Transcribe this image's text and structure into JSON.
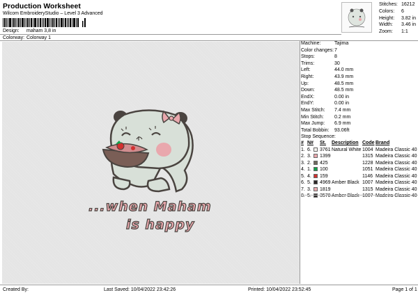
{
  "header": {
    "title": "Production Worksheet",
    "subtitle": "Wilcom EmbroideryStudio – Level 3 Advanced",
    "design_label": "Design:",
    "design_value": "maham 3,8 in",
    "colorway_label": "Colorway:",
    "colorway_value": "Colorway 1"
  },
  "top_stats": [
    {
      "label": "Stitches:",
      "value": "16212"
    },
    {
      "label": "Colors:",
      "value": "6"
    },
    {
      "label": "Height:",
      "value": "3.82 in"
    },
    {
      "label": "Width:",
      "value": "3.46 in"
    },
    {
      "label": "Zoom:",
      "value": "1:1"
    }
  ],
  "details": [
    {
      "label": "Machine:",
      "value": "Tajima"
    },
    {
      "label": "Color changes:",
      "value": "7"
    },
    {
      "label": "Stops:",
      "value": "8"
    },
    {
      "label": "Trims:",
      "value": "30"
    },
    {
      "label": "Left:",
      "value": "44.0 mm"
    },
    {
      "label": "Right:",
      "value": "43.9 mm"
    },
    {
      "label": "Up:",
      "value": "48.5 mm"
    },
    {
      "label": "Down:",
      "value": "48.5 mm"
    },
    {
      "label": "EndX:",
      "value": "0.00 in"
    },
    {
      "label": "EndY:",
      "value": "0.00 in"
    },
    {
      "label": "Max Stitch:",
      "value": "7.4 mm"
    },
    {
      "label": "Min Stitch:",
      "value": "0.2 mm"
    },
    {
      "label": "Max Jump:",
      "value": "6.9 mm"
    },
    {
      "label": "Total Bobbin:",
      "value": "93.06ft"
    }
  ],
  "stop_sequence": {
    "title": "Stop Sequence:",
    "headers": [
      "#",
      "N#",
      "St.",
      "Description",
      "Code",
      "Brand"
    ],
    "rows": [
      {
        "num": "1.",
        "n": "6.",
        "color": "#f4f2ee",
        "st": "3761",
        "desc": "Natural White",
        "code": "1004",
        "brand": "Madeira Classic 40"
      },
      {
        "num": "2.",
        "n": "3.",
        "color": "#e9a8ad",
        "st": "1399",
        "desc": "",
        "code": "1315",
        "brand": "Madeira Classic 40"
      },
      {
        "num": "3.",
        "n": "2.",
        "color": "#6f6a5f",
        "st": "425",
        "desc": "",
        "code": "1228",
        "brand": "Madeira Classic 40"
      },
      {
        "num": "4.",
        "n": "1.",
        "color": "#12a04a",
        "st": "100",
        "desc": "",
        "code": "1051",
        "brand": "Madeira Classic 40"
      },
      {
        "num": "5.",
        "n": "4.",
        "color": "#d2302f",
        "st": "159",
        "desc": "",
        "code": "1146",
        "brand": "Madeira Classic 40"
      },
      {
        "num": "6.",
        "n": "5.",
        "color": "#2f2a2a",
        "st": "4969",
        "desc": "Amber Black",
        "code": "1007",
        "brand": "Madeira Classic 40"
      },
      {
        "num": "7.",
        "n": "3.",
        "color": "#e9a8ad",
        "st": "1819",
        "desc": "",
        "code": "1315",
        "brand": "Madeira Classic 40"
      },
      {
        "num": "8.",
        "n": "5.",
        "color": "#2f2a2a",
        "st": "3578",
        "desc": "Amber Black",
        "code": "1007",
        "brand": "Madeira Classic 40"
      }
    ]
  },
  "design_text": {
    "line1": "...when Maham",
    "line2": "is happy"
  },
  "footer": {
    "created_by": "Created By:",
    "last_saved": "Last Saved: 10/04/2022 23:42:26",
    "printed": "Printed: 10/04/2022 23:52:45",
    "page": "Page 1 of 1"
  },
  "colors": {
    "canvas_bg": "#e5e5e5",
    "body_fill": "#d8e0d8",
    "outline": "#4a4440",
    "pink": "#e9a8ad"
  }
}
